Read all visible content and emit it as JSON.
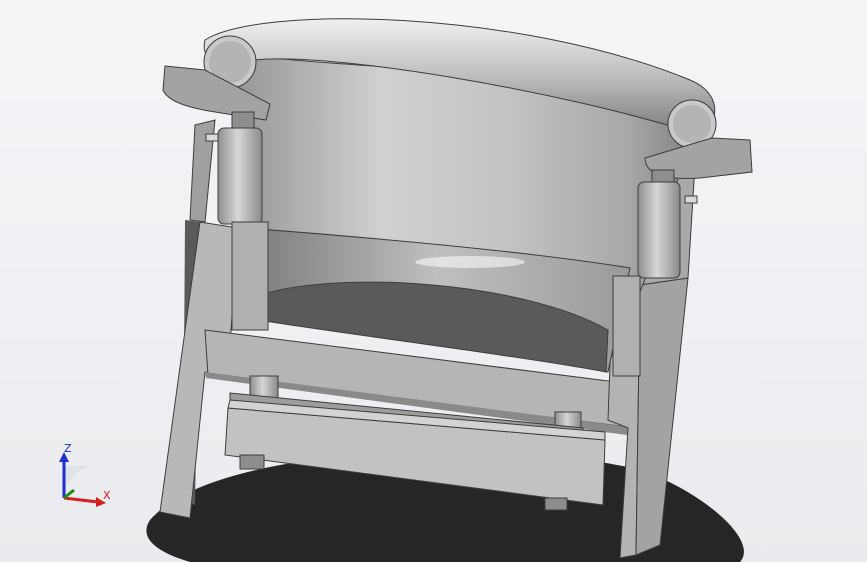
{
  "viewport": {
    "background_top": "#f4f5f7",
    "background_bottom": "#e9ebee"
  },
  "model": {
    "body_color": "#b9b9b9",
    "dark_face_color": "#575757",
    "shadow_color": "#2c2c2c"
  },
  "triad": {
    "x_label": "X",
    "z_label": "Z",
    "x_color": "#d42020",
    "z_color": "#1d2fd0",
    "y_color": "#1a8f1a"
  }
}
